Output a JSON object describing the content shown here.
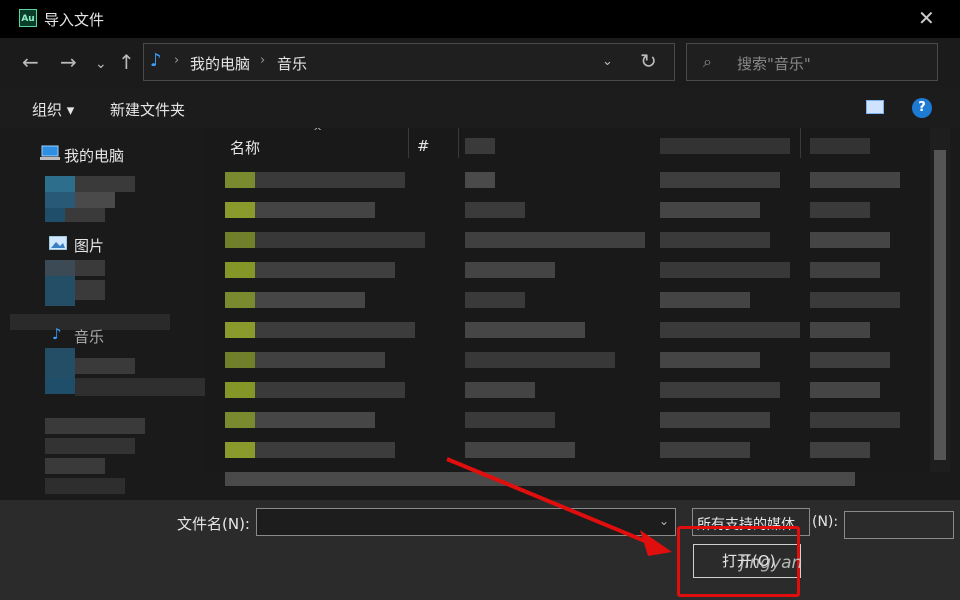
{
  "window": {
    "title": "导入文件",
    "app_icon_text": "Au",
    "close_glyph": "✕"
  },
  "nav": {
    "back": "←",
    "forward": "→",
    "history": "⌄",
    "up": "↑"
  },
  "address": {
    "crumbs": [
      "我的电脑",
      "音乐"
    ],
    "separator": "›",
    "dropdown": "⌄",
    "refresh": "↻",
    "music_glyph": "♪"
  },
  "search": {
    "placeholder": "搜索\"音乐\"",
    "icon": "⌕"
  },
  "toolbar": {
    "organize": "组织 ▾",
    "new_folder": "新建文件夹",
    "help": "?"
  },
  "sidebar": {
    "items": [
      "我的电脑",
      "图片",
      "音乐"
    ]
  },
  "files": {
    "columns": [
      "名称",
      "#"
    ]
  },
  "bottom": {
    "filename_label": "文件名(N):",
    "filetype_value": "所有支持的媒体",
    "filetype_suffix": "(N):",
    "open_label": "打开(O)"
  },
  "watermark": "jingyan",
  "colors": {
    "annotation": "#e10e0e",
    "accent": "#1e7bd4"
  }
}
